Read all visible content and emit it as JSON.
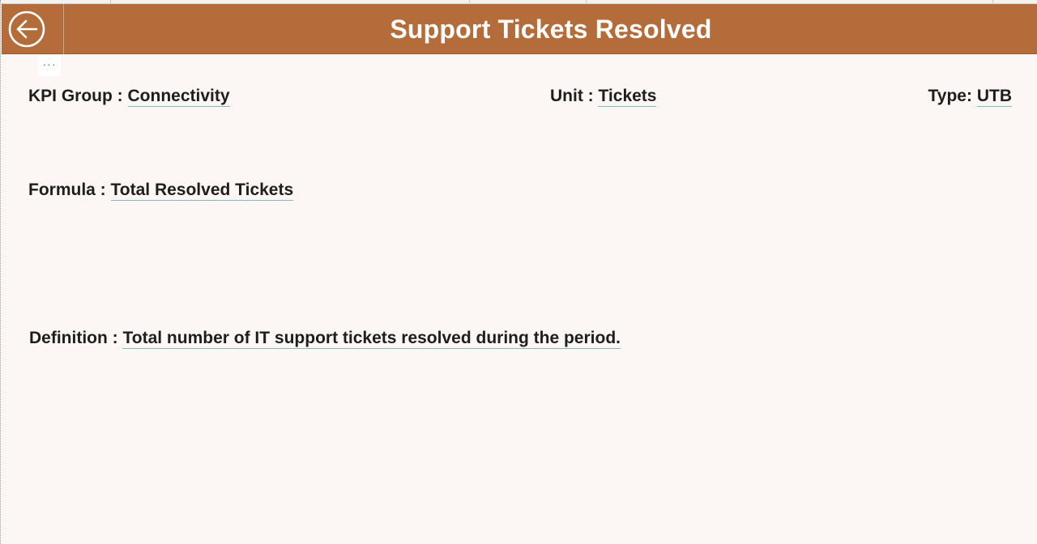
{
  "header": {
    "title": "Support Tickets Resolved",
    "back_icon": "arrow-left-circle-icon",
    "background_color": "#b46c3a"
  },
  "more_options": {
    "label": "···",
    "icon": "ellipsis-icon"
  },
  "details": {
    "kpi_group": {
      "label": "KPI Group : ",
      "value": "Connectivity"
    },
    "unit": {
      "label": "Unit : ",
      "value": "Tickets"
    },
    "type": {
      "label": "Type: ",
      "value": "UTB"
    },
    "formula": {
      "label": "Formula : ",
      "value": "Total Resolved Tickets"
    },
    "definition": {
      "label": "Definition : ",
      "value": "Total number of IT support tickets resolved during the period."
    }
  },
  "colors": {
    "page_background": "#fcf7f4",
    "text": "#1e1e1e",
    "value_underline": "#7fbcb8"
  }
}
